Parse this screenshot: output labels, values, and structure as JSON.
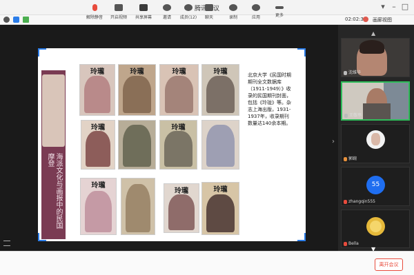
{
  "window": {
    "title": "腾讯会议"
  },
  "status": {
    "timer": "02:02:36",
    "view": "画廊视图"
  },
  "slide": {
    "panel_title": "海派文化与画报中的民国摩登",
    "description": "北京大学《民国时期期刊全文数据库（1911-1949）》收录的民国期刊封面，包括《玲珑》等。杂志上海出版，1931-1937年，收录期刊数量达140余本期。",
    "masthead": "玲瓏"
  },
  "participants": [
    {
      "name": "沈维华",
      "type": "video"
    },
    {
      "name": "王敬亭",
      "type": "video"
    },
    {
      "name": "郭婉",
      "type": "avatar"
    },
    {
      "name": "zhangqin555",
      "type": "initials",
      "initials": "55"
    },
    {
      "name": "Bella",
      "type": "avatar"
    }
  ],
  "toolbar": {
    "items": [
      "解除静音",
      "开启视频",
      "共享屏幕",
      "邀请",
      "成员(12)",
      "聊天",
      "录制",
      "应用",
      "更多"
    ],
    "end": "离开会议"
  },
  "colors": {
    "accent": "#2b7de9",
    "end": "#e84b3c",
    "panel": "#7a3b53"
  }
}
